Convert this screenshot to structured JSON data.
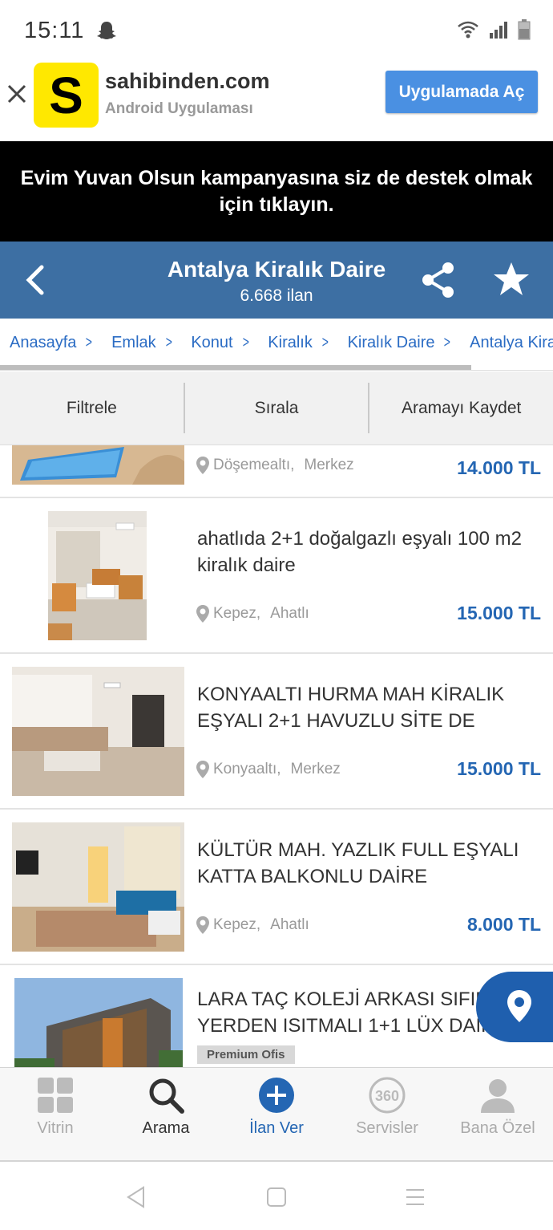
{
  "status": {
    "time": "15:11"
  },
  "banner": {
    "logo_letter": "S",
    "title": "sahibinden.com",
    "subtitle": "Android Uygulaması",
    "open_button": "Uygulamada Aç"
  },
  "campaign": {
    "text": "Evim Yuvan Olsun kampanyasına siz de destek olmak için tıklayın."
  },
  "header": {
    "title": "Antalya Kiralık Daire",
    "count": "6.668 ilan"
  },
  "breadcrumb": [
    "Anasayfa",
    "Emlak",
    "Konut",
    "Kiralık",
    "Kiralık Daire",
    "Antalya Kiralık"
  ],
  "toolbar": {
    "filter": "Filtrele",
    "sort": "Sırala",
    "save_search": "Aramayı Kaydet"
  },
  "listings": [
    {
      "title": "",
      "district": "Döşemealtı,",
      "neighborhood": "Merkez",
      "price": "14.000 TL"
    },
    {
      "title": "ahatlıda 2+1 doğalgazlı eşyalı 100 m2 kiralık daire",
      "district": "Kepez,",
      "neighborhood": "Ahatlı",
      "price": "15.000 TL"
    },
    {
      "title": "KONYAALTI HURMA MAH KİRALIK EŞYALI 2+1 HAVUZLU SİTE DE",
      "district": "Konyaaltı,",
      "neighborhood": "Merkez",
      "price": "15.000 TL"
    },
    {
      "title": "KÜLTÜR MAH. YAZLIK FULL EŞYALI KATTA BALKONLU DAİRE",
      "district": "Kepez,",
      "neighborhood": "Ahatlı",
      "price": "8.000 TL"
    },
    {
      "title": "LARA TAÇ KOLEJİ ARKASI SIFIR YERDEN ISITMALI 1+1 LÜX DAİRE",
      "badge": "Premium Ofis"
    }
  ],
  "bottom_nav": [
    {
      "label": "Vitrin",
      "icon": "grid-icon"
    },
    {
      "label": "Arama",
      "icon": "search-icon"
    },
    {
      "label": "İlan Ver",
      "icon": "plus-circle-icon"
    },
    {
      "label": "Servisler",
      "icon": "360-icon"
    },
    {
      "label": "Bana Özel",
      "icon": "user-icon"
    }
  ],
  "colors": {
    "header": "#3d6fa3",
    "accent": "#2466b3",
    "logo": "#ffe800",
    "button": "#4a90e2"
  }
}
